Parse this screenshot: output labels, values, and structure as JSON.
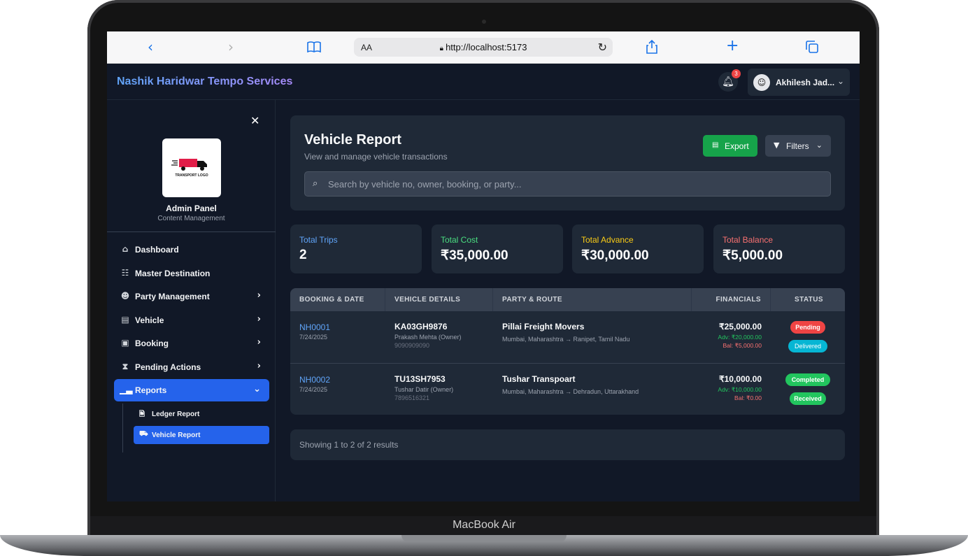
{
  "device": {
    "label": "MacBook Air"
  },
  "browser": {
    "text_size_label": "AA",
    "url": "http://localhost:5173"
  },
  "header": {
    "title": "Nashik Haridwar Tempo Services",
    "notification_count": "3",
    "user_name": "Akhilesh Jad..."
  },
  "sidebar": {
    "logo_text": "TRANSPORT LOGO",
    "panel_title": "Admin Panel",
    "panel_subtitle": "Content Management",
    "items": [
      {
        "label": "Dashboard",
        "icon": "home-icon"
      },
      {
        "label": "Master Destination",
        "icon": "sitemap-icon"
      },
      {
        "label": "Party Management",
        "icon": "user-check-icon"
      },
      {
        "label": "Vehicle",
        "icon": "box-icon"
      },
      {
        "label": "Booking",
        "icon": "book-icon"
      },
      {
        "label": "Pending Actions",
        "icon": "hourglass-icon"
      },
      {
        "label": "Reports",
        "icon": "bar-chart-icon"
      }
    ],
    "sub_items": [
      {
        "label": "Ledger Report",
        "icon": "file-icon"
      },
      {
        "label": "Vehicle Report",
        "icon": "truck-icon"
      }
    ]
  },
  "report": {
    "title": "Vehicle Report",
    "subtitle": "View and manage vehicle transactions",
    "export_label": "Export",
    "filters_label": "Filters",
    "search_placeholder": "Search by vehicle no, owner, booking, or party..."
  },
  "stats": [
    {
      "label": "Total Trips",
      "value": "2",
      "color": "#60a5fa"
    },
    {
      "label": "Total Cost",
      "value": "₹35,000.00",
      "color": "#4ade80"
    },
    {
      "label": "Total Advance",
      "value": "₹30,000.00",
      "color": "#facc15"
    },
    {
      "label": "Total Balance",
      "value": "₹5,000.00",
      "color": "#f87171"
    }
  ],
  "table": {
    "columns": [
      "BOOKING & DATE",
      "VEHICLE DETAILS",
      "PARTY & ROUTE",
      "FINANCIALS",
      "STATUS"
    ],
    "rows": [
      {
        "booking": "NH0001",
        "date": "7/24/2025",
        "vehicle_no": "KA03GH9876",
        "owner": "Prakash Mehta (Owner)",
        "phone": "9090909090",
        "party": "Pillai Freight Movers",
        "route": "Mumbai, Maharashtra → Ranipet, Tamil Nadu",
        "total": "₹25,000.00",
        "advance": "Adv: ₹20,000.00",
        "balance": "Bal: ₹5,000.00",
        "status1": "Pending",
        "status2": "Delivered"
      },
      {
        "booking": "NH0002",
        "date": "7/24/2025",
        "vehicle_no": "TU13SH7953",
        "owner": "Tushar Datir (Owner)",
        "phone": "7896516321",
        "party": "Tushar Transpoart",
        "route": "Mumbai, Maharashtra → Dehradun, Uttarakhand",
        "total": "₹10,000.00",
        "advance": "Adv: ₹10,000.00",
        "balance": "Bal: ₹0.00",
        "status1": "Completed",
        "status2": "Received"
      }
    ]
  },
  "footer": {
    "results_text": "Showing 1 to 2 of 2 results"
  },
  "colors": {
    "accent": "#2563eb",
    "export_green": "#16a34a",
    "pending_red": "#ef4444",
    "delivered_cyan": "#06b6d4",
    "completed_green": "#22c55e"
  }
}
